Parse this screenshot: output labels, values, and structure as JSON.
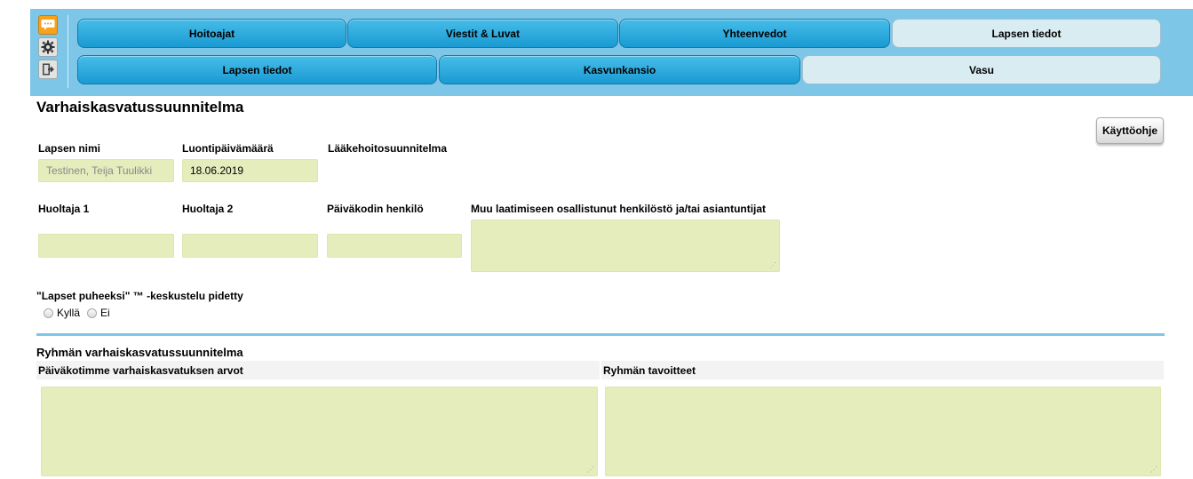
{
  "nav": {
    "row1": [
      "Hoitoajat",
      "Viestit & Luvat",
      "Yhteenvedot",
      "Lapsen tiedot"
    ],
    "row2": [
      "Lapsen tiedot",
      "Kasvunkansio",
      "Vasu"
    ],
    "active_row1": "Lapsen tiedot",
    "active_row2": "Vasu",
    "side_icons": [
      "chat-icon",
      "gear-icon",
      "logout-icon"
    ]
  },
  "page": {
    "title": "Varhaiskasvatussuunnitelma",
    "help_button": "Käyttöohje"
  },
  "child": {
    "name_label": "Lapsen nimi",
    "name_value": "Testinen, Teija Tuulikki",
    "date_label": "Luontipäivämäärä",
    "date_value": "18.06.2019",
    "medication_label": "Lääkehoitosuunnitelma"
  },
  "people": {
    "guardian1_label": "Huoltaja 1",
    "guardian2_label": "Huoltaja 2",
    "daycare_person_label": "Päiväkodin henkilö",
    "other_staff_label": "Muu laatimiseen osallistunut henkilöstö ja/tai asiantuntijat"
  },
  "discussion": {
    "label": "\"Lapset puheeksi\" ™ -keskustelu pidetty",
    "yes": "Kyllä",
    "no": "Ei"
  },
  "group": {
    "title": "Ryhmän varhaiskasvatussuunnitelma",
    "values_label": "Päiväkotimme varhaiskasvatuksen arvot",
    "goals_label": "Ryhmän tavoitteet"
  },
  "colors": {
    "topbar": "#7ec6e8",
    "tab": "#1fa3db",
    "tab_active": "#d9ecf2",
    "field": "#e6edbd"
  }
}
